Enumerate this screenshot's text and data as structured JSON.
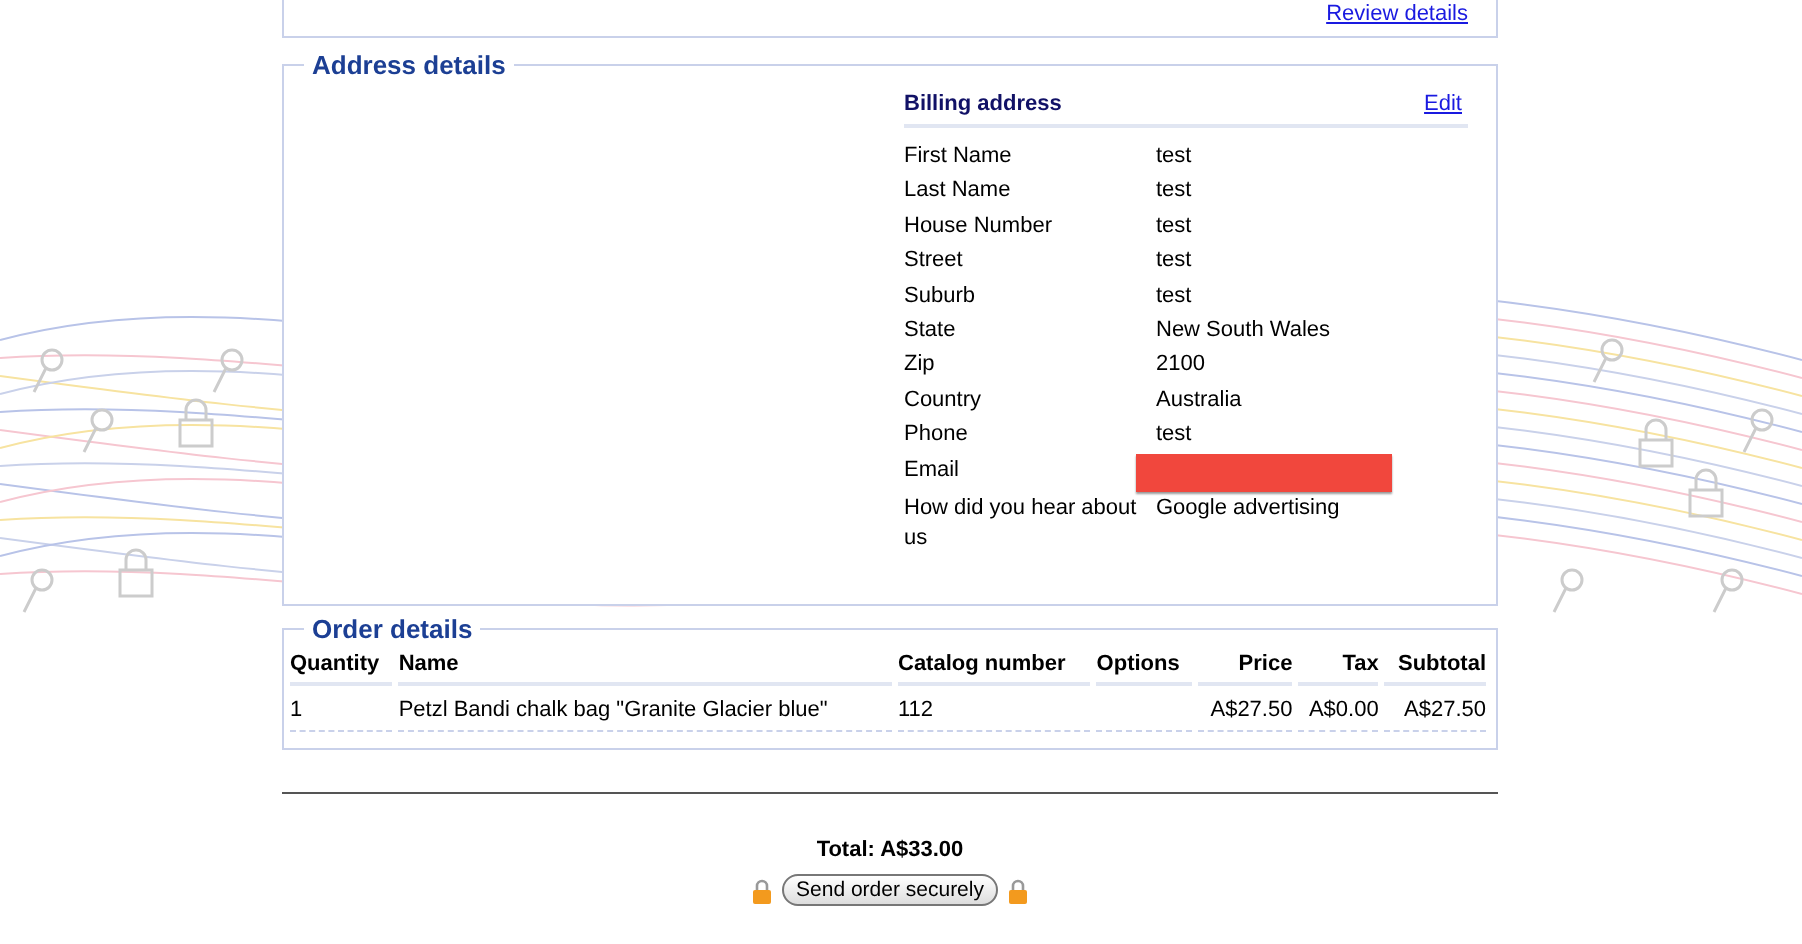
{
  "review_link": "Review details",
  "address_details": {
    "legend": "Address details",
    "billing": {
      "title": "Billing address",
      "edit": "Edit",
      "rows": [
        {
          "kind": "text",
          "label": "First Name",
          "value": "test"
        },
        {
          "kind": "text",
          "label": "Last Name",
          "value": "test"
        },
        {
          "kind": "text",
          "label": "House Number",
          "value": "test"
        },
        {
          "kind": "text",
          "label": "Street",
          "value": "test"
        },
        {
          "kind": "text",
          "label": "Suburb",
          "value": "test"
        },
        {
          "kind": "text",
          "label": "State",
          "value": "New South Wales"
        },
        {
          "kind": "text",
          "label": "Zip",
          "value": "2100"
        },
        {
          "kind": "text",
          "label": "Country",
          "value": "Australia"
        },
        {
          "kind": "text",
          "label": "Phone",
          "value": "test"
        },
        {
          "kind": "redacted",
          "label": "Email"
        },
        {
          "kind": "text",
          "label": "How did you hear about us",
          "value": "Google advertising"
        }
      ]
    }
  },
  "order_details": {
    "legend": "Order details",
    "columns": [
      "Quantity",
      "Name",
      "Catalog number",
      "Options",
      "Price",
      "Tax",
      "Subtotal"
    ],
    "rows": [
      [
        "1",
        "Petzl Bandi chalk bag \"Granite Glacier blue\"",
        "112",
        "",
        "A$27.50",
        "A$0.00",
        "A$27.50"
      ]
    ]
  },
  "total": "Total: A$33.00",
  "submit": "Send order securely"
}
